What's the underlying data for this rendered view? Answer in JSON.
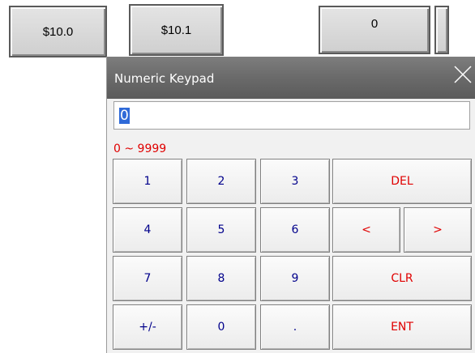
{
  "top_buttons": {
    "btn1": "$10.0",
    "btn2": "$10.1",
    "numeric_display": "0"
  },
  "keypad": {
    "title": "Numeric Keypad",
    "close_icon": "close-x-icon",
    "entry_value": "0",
    "range": "0 ~ 9999",
    "keys": {
      "k1": "1",
      "k2": "2",
      "k3": "3",
      "del": "DEL",
      "k4": "4",
      "k5": "5",
      "k6": "6",
      "left": "<",
      "right": ">",
      "k7": "7",
      "k8": "8",
      "k9": "9",
      "clr": "CLR",
      "sign": "+/-",
      "k0": "0",
      "dot": ".",
      "ent": "ENT"
    }
  },
  "colors": {
    "titlebar": "#6a6a6a",
    "digit_text": "#00008b",
    "function_text": "#e00000",
    "selection": "#2f6ad8"
  }
}
